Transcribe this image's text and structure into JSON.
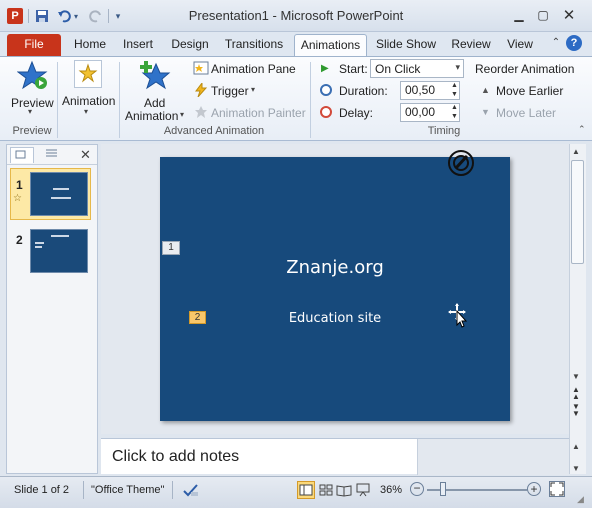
{
  "window": {
    "title": "Presentation1 - Microsoft PowerPoint"
  },
  "tabs": [
    {
      "label": "File"
    },
    {
      "label": "Home"
    },
    {
      "label": "Insert"
    },
    {
      "label": "Design"
    },
    {
      "label": "Transitions"
    },
    {
      "label": "Animations"
    },
    {
      "label": "Slide Show"
    },
    {
      "label": "Review"
    },
    {
      "label": "View"
    }
  ],
  "ribbon": {
    "preview": {
      "button": "Preview",
      "group": "Preview"
    },
    "animation": {
      "button": "Animation"
    },
    "advanced": {
      "add_animation": "Add",
      "add_animation_2": "Animation",
      "pane": "Animation Pane",
      "trigger": "Trigger",
      "painter": "Animation Painter",
      "group": "Advanced Animation"
    },
    "timing": {
      "start_label": "Start:",
      "start_value": "On Click",
      "duration_label": "Duration:",
      "duration_value": "00,50",
      "delay_label": "Delay:",
      "delay_value": "00,00",
      "reorder": "Reorder Animation",
      "move_earlier": "Move Earlier",
      "move_later": "Move Later",
      "group": "Timing"
    }
  },
  "slides_pane": {
    "thumbs": [
      {
        "number": "1",
        "selected": true
      },
      {
        "number": "2",
        "selected": false
      }
    ]
  },
  "slide": {
    "title": "Znanje.org",
    "subtitle": "Education site",
    "anim_tag_1": "1",
    "anim_tag_2": "2"
  },
  "notes": {
    "placeholder": "Click to add notes"
  },
  "status": {
    "slide_counter": "Slide 1 of 2",
    "theme": "\"Office Theme\"",
    "zoom": "36%"
  },
  "colors": {
    "slide_bg": "#174a7c",
    "file_tab": "#c8341b",
    "accent": "#2b579a"
  }
}
